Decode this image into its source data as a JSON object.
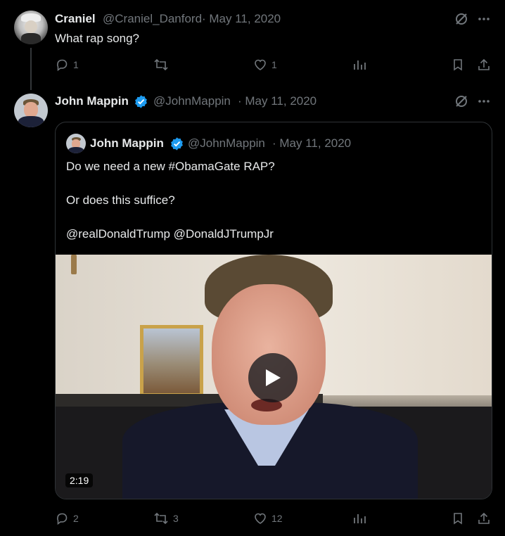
{
  "reply": {
    "name": "Craniel",
    "handle": "@Craniel_Danford",
    "date": "· May 11, 2020",
    "text": "What rap song?",
    "actions": {
      "replies": "1",
      "reposts": "",
      "likes": "1"
    }
  },
  "tweet": {
    "name": "John Mappin",
    "handle": "@JohnMappin",
    "date": "· May 11, 2020",
    "actions": {
      "replies": "2",
      "reposts": "3",
      "likes": "12"
    }
  },
  "quote": {
    "name": "John Mappin",
    "handle": "@JohnMappin",
    "date": "· May 11, 2020",
    "line1": "Do we need a new #ObamaGate RAP?",
    "line2": "Or does this suffice?",
    "line3": "@realDonaldTrump @DonaldJTrumpJr",
    "video_duration": "2:19"
  },
  "colors": {
    "verified": "#1d9bf0",
    "muted": "#71767b",
    "text": "#e7e9ea"
  },
  "icons": [
    "grok-icon",
    "more-icon",
    "reply-icon",
    "repost-icon",
    "like-icon",
    "views-icon",
    "bookmark-icon",
    "share-icon",
    "verified-badge-icon",
    "play-icon"
  ]
}
